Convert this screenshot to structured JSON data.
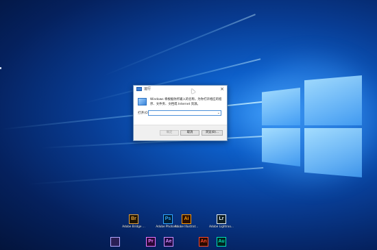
{
  "run_dialog": {
    "title": "运行",
    "close": "×",
    "description": "Windows 将根据你所输入的名称，为你打开相应的程序、文件夹、文档或 Internet 资源。",
    "open_label": "打开(O):",
    "open_value": "",
    "dropdown_arrow": "⌄",
    "ok_button": "确定",
    "cancel_button": "取消",
    "browse_button": "浏览(B)..."
  },
  "desktop": {
    "icons_row1": [
      {
        "abbr": "Br",
        "label": "Adobe Bridge ...",
        "bg": "#1f1402",
        "fg": "#e6a33b",
        "icon": "adobe-bridge-icon"
      },
      {
        "abbr": "Ps",
        "label": "Adobe Photosh...",
        "bg": "#001d34",
        "fg": "#31a8ff",
        "icon": "adobe-photoshop-icon"
      },
      {
        "abbr": "Ai",
        "label": "Adobe Illustrat...",
        "bg": "#2b0e00",
        "fg": "#ff9a00",
        "icon": "adobe-illustrator-icon"
      },
      {
        "abbr": "Lr",
        "label": "Adobe Lightroo...",
        "bg": "#0f1e24",
        "fg": "#e6f0f5",
        "icon": "adobe-lightroom-icon"
      }
    ],
    "icons_row2": [
      {
        "abbr": "",
        "label": "",
        "bg": "#2a1f55",
        "fg": "#b7a8ff",
        "icon": "app-shortcut-icon"
      },
      {
        "abbr": "Pr",
        "label": "",
        "bg": "#2a0634",
        "fg": "#ea77ff",
        "icon": "adobe-premiere-icon"
      },
      {
        "abbr": "Ae",
        "label": "",
        "bg": "#1f0740",
        "fg": "#d291ff",
        "icon": "adobe-after-effects-icon"
      },
      {
        "abbr": "An",
        "label": "",
        "bg": "#2a0a00",
        "fg": "#ff4a2b",
        "icon": "adobe-animate-icon"
      },
      {
        "abbr": "Au",
        "label": "",
        "bg": "#00241f",
        "fg": "#00e4bb",
        "icon": "adobe-audition-icon"
      }
    ]
  }
}
